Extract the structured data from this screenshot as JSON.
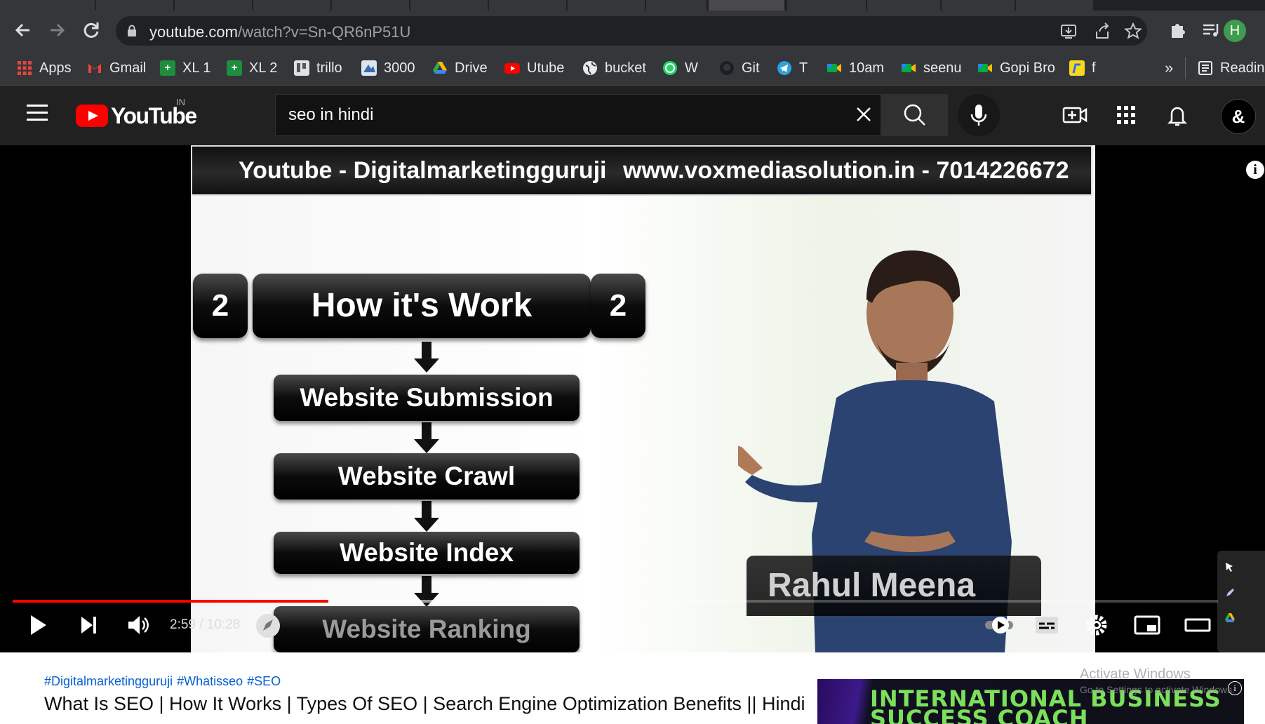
{
  "browser": {
    "url_host": "youtube.com",
    "url_path": "/watch?v=Sn-QR6nP51U",
    "profile_initial": "H",
    "bookmarks": [
      {
        "label": "Apps",
        "icon": "apps-grid-icon"
      },
      {
        "label": "Gmail",
        "icon": "gmail-icon"
      },
      {
        "label": "XL 1",
        "icon": "sheets-plus-icon"
      },
      {
        "label": "XL 2",
        "icon": "sheets-plus-icon"
      },
      {
        "label": "trillo",
        "icon": "trello-icon"
      },
      {
        "label": "3000",
        "icon": "site-icon"
      },
      {
        "label": "Drive",
        "icon": "drive-icon"
      },
      {
        "label": "Utube",
        "icon": "youtube-icon"
      },
      {
        "label": "bucket",
        "icon": "globe-icon"
      },
      {
        "label": "W",
        "icon": "whatsapp-icon"
      },
      {
        "label": "Git",
        "icon": "github-icon"
      },
      {
        "label": "T",
        "icon": "telegram-icon"
      },
      {
        "label": "10am",
        "icon": "meet-icon"
      },
      {
        "label": "seenu",
        "icon": "meet-icon"
      },
      {
        "label": "Gopi Bro",
        "icon": "meet-icon"
      },
      {
        "label": "f",
        "icon": "flipkart-icon"
      }
    ],
    "bookmarks_overflow": "»",
    "reading_list": "Reading"
  },
  "youtube": {
    "logo_text": "YouTube",
    "country": "IN",
    "search_value": "seo in hindi"
  },
  "video": {
    "banner_left": "Youtube - Digitalmarketingguruji",
    "banner_right": "www.voxmediasolution.in - 7014226672",
    "step_number": "2",
    "heading": "How it's Work",
    "steps": [
      "Website Submission",
      "Website Crawl",
      "Website Index",
      "Website Ranking"
    ],
    "presenter_name": "Rahul Meena",
    "time_current": "2:59",
    "time_separator": " / ",
    "time_total": "10:28",
    "progress_played": 0.262,
    "progress_buffered": 0.462
  },
  "below": {
    "hashtags": [
      "#Digitalmarketingguruji",
      "#Whatisseo",
      "#SEO"
    ],
    "title": "What Is SEO | How It Works | Types Of SEO | Search Engine Optimization Benefits || Hindi",
    "ad_line1": "INTERNATIONAL BUSINESS",
    "ad_line2": "SUCCESS COACH"
  },
  "watermark": {
    "line1": "Activate Windows",
    "line2": "Go to Settings to activate Windows."
  },
  "colors": {
    "youtube_red": "#ff0000",
    "link_blue": "#065fd4",
    "chrome_bg": "#35363a"
  }
}
